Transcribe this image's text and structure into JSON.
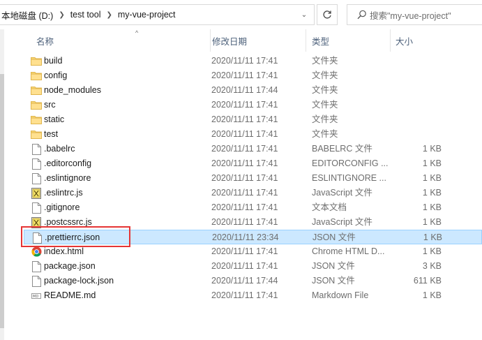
{
  "address": {
    "crumbs": [
      "本地磁盘 (D:)",
      "test tool",
      "my-vue-project"
    ],
    "dropdown_glyph": "⌄"
  },
  "search": {
    "placeholder": "搜索\"my-vue-project\""
  },
  "columns": {
    "name": "名称",
    "date": "修改日期",
    "type": "类型",
    "size": "大小",
    "sort_glyph": "^"
  },
  "files": [
    {
      "name": "build",
      "date": "2020/11/11 17:41",
      "type": "文件夹",
      "size": "",
      "icon": "folder"
    },
    {
      "name": "config",
      "date": "2020/11/11 17:41",
      "type": "文件夹",
      "size": "",
      "icon": "folder"
    },
    {
      "name": "node_modules",
      "date": "2020/11/11 17:44",
      "type": "文件夹",
      "size": "",
      "icon": "folder"
    },
    {
      "name": "src",
      "date": "2020/11/11 17:41",
      "type": "文件夹",
      "size": "",
      "icon": "folder"
    },
    {
      "name": "static",
      "date": "2020/11/11 17:41",
      "type": "文件夹",
      "size": "",
      "icon": "folder"
    },
    {
      "name": "test",
      "date": "2020/11/11 17:41",
      "type": "文件夹",
      "size": "",
      "icon": "folder"
    },
    {
      "name": ".babelrc",
      "date": "2020/11/11 17:41",
      "type": "BABELRC 文件",
      "size": "1 KB",
      "icon": "file"
    },
    {
      "name": ".editorconfig",
      "date": "2020/11/11 17:41",
      "type": "EDITORCONFIG ...",
      "size": "1 KB",
      "icon": "file"
    },
    {
      "name": ".eslintignore",
      "date": "2020/11/11 17:41",
      "type": "ESLINTIGNORE ...",
      "size": "1 KB",
      "icon": "file"
    },
    {
      "name": ".eslintrc.js",
      "date": "2020/11/11 17:41",
      "type": "JavaScript 文件",
      "size": "1 KB",
      "icon": "js"
    },
    {
      "name": ".gitignore",
      "date": "2020/11/11 17:41",
      "type": "文本文档",
      "size": "1 KB",
      "icon": "file"
    },
    {
      "name": ".postcssrc.js",
      "date": "2020/11/11 17:41",
      "type": "JavaScript 文件",
      "size": "1 KB",
      "icon": "js"
    },
    {
      "name": ".prettierrc.json",
      "date": "2020/11/11 23:34",
      "type": "JSON 文件",
      "size": "1 KB",
      "icon": "file",
      "selected": true
    },
    {
      "name": "index.html",
      "date": "2020/11/11 17:41",
      "type": "Chrome HTML D...",
      "size": "1 KB",
      "icon": "chrome"
    },
    {
      "name": "package.json",
      "date": "2020/11/11 17:41",
      "type": "JSON 文件",
      "size": "3 KB",
      "icon": "file"
    },
    {
      "name": "package-lock.json",
      "date": "2020/11/11 17:44",
      "type": "JSON 文件",
      "size": "611 KB",
      "icon": "file"
    },
    {
      "name": "README.md",
      "date": "2020/11/11 17:41",
      "type": "Markdown File",
      "size": "1 KB",
      "icon": "md"
    }
  ]
}
